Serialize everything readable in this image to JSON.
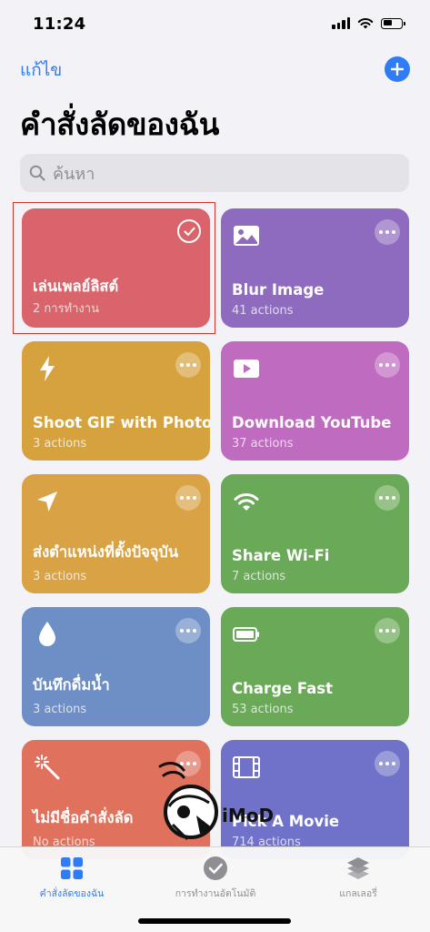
{
  "status_bar": {
    "time": "11:24"
  },
  "header": {
    "edit_label": "แก้ไข",
    "title": "คำสั่งลัดของฉัน"
  },
  "search": {
    "placeholder": "ค้นหา"
  },
  "tiles": [
    {
      "title": "เล่นเพลย์ลิสต์",
      "subtitle": "2 การทำงาน",
      "color": "#d9646b",
      "icon": "check-icon",
      "selected": true
    },
    {
      "title": "Blur Image",
      "subtitle": "41 actions",
      "color": "#8e6bbf",
      "icon": "image-icon"
    },
    {
      "title": "Shoot GIF with Photos",
      "subtitle": "3 actions",
      "color": "#d6a23e",
      "icon": "bolt-icon"
    },
    {
      "title": "Download YouTube",
      "subtitle": "37 actions",
      "color": "#bf6bbf",
      "icon": "play-icon"
    },
    {
      "title": "ส่งตำแหน่งที่ตั้งปัจจุบัน",
      "subtitle": "3 actions",
      "color": "#d9a245",
      "icon": "location-arrow-icon"
    },
    {
      "title": "Share Wi-Fi",
      "subtitle": "7 actions",
      "color": "#6aa957",
      "icon": "wifi-icon"
    },
    {
      "title": "บันทึกดื่มน้ำ",
      "subtitle": "3 actions",
      "color": "#6d8fc6",
      "icon": "water-drop-icon"
    },
    {
      "title": "Charge Fast",
      "subtitle": "53 actions",
      "color": "#6aa957",
      "icon": "battery-icon"
    },
    {
      "title": "ไม่มีชื่อคำสั่งลัด",
      "subtitle": "No actions",
      "color": "#e0715d",
      "icon": "magic-wand-icon"
    },
    {
      "title": "Pick A Movie",
      "subtitle": "714 actions",
      "color": "#6f72c8",
      "icon": "film-icon"
    }
  ],
  "tab_bar": {
    "tabs": [
      {
        "label": "คำสั่งลัดของฉัน",
        "icon": "grid-icon",
        "active": true
      },
      {
        "label": "การทำงานอัตโนมัติ",
        "icon": "clock-icon",
        "active": false
      },
      {
        "label": "แกลเลอรี่",
        "icon": "layers-icon",
        "active": false
      }
    ]
  },
  "watermark": {
    "text": "iMoD"
  },
  "colors": {
    "accent": "#2f7cf6",
    "selection_outline": "#d4342c"
  }
}
